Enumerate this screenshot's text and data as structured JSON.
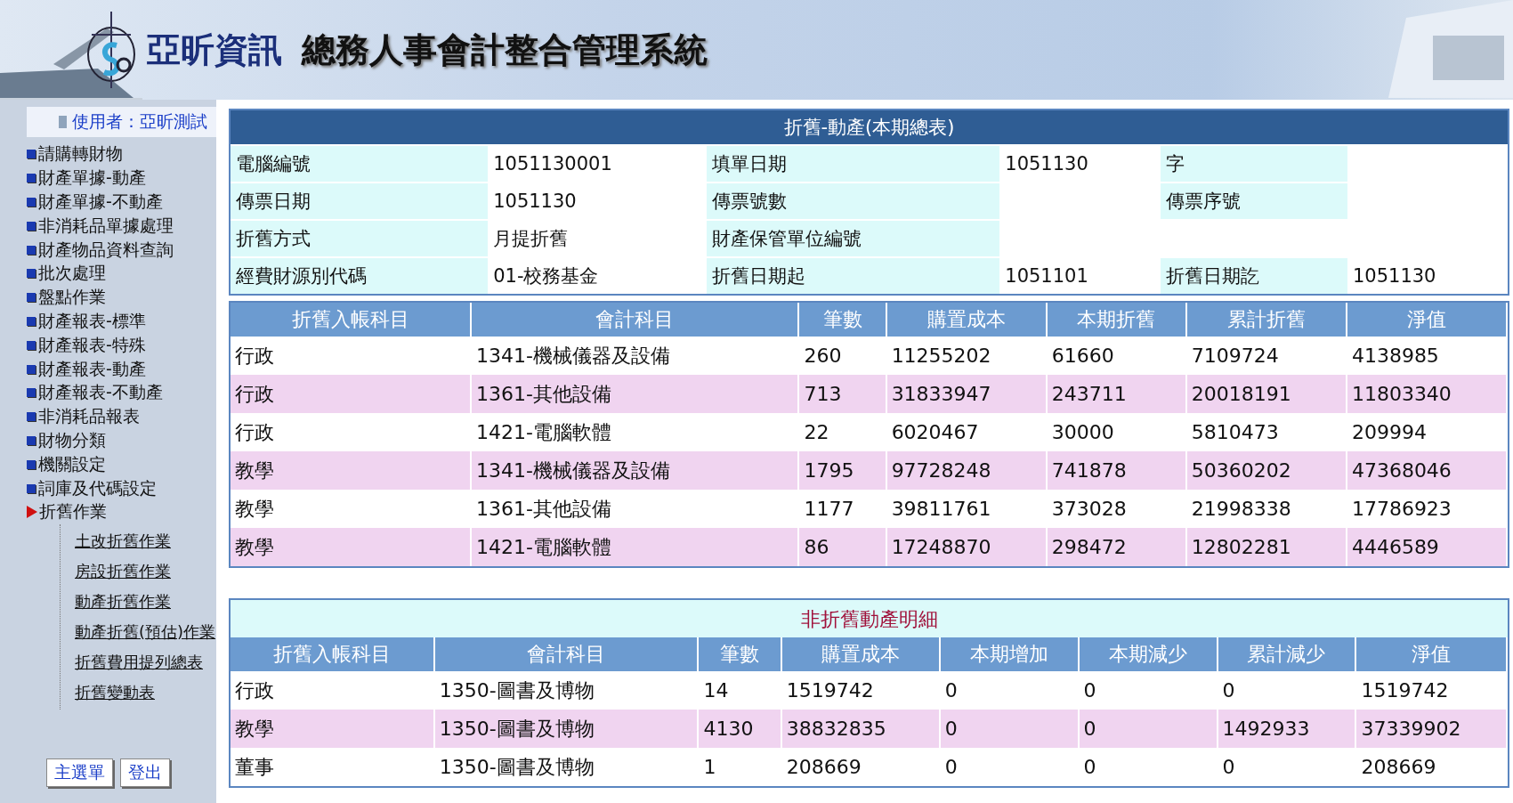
{
  "header": {
    "company": "亞昕資訊",
    "system": "總務人事會計整合管理系統"
  },
  "sidebar": {
    "user": "使用者：亞昕測試",
    "items": [
      {
        "label": "請購轉財物",
        "expanded": false
      },
      {
        "label": "財產單據-動產",
        "expanded": false
      },
      {
        "label": "財產單據-不動產",
        "expanded": false
      },
      {
        "label": "非消耗品單據處理",
        "expanded": false
      },
      {
        "label": "財產物品資料查詢",
        "expanded": false
      },
      {
        "label": "批次處理",
        "expanded": false
      },
      {
        "label": "盤點作業",
        "expanded": false
      },
      {
        "label": "財產報表-標準",
        "expanded": false
      },
      {
        "label": "財產報表-特殊",
        "expanded": false
      },
      {
        "label": "財產報表-動產",
        "expanded": false
      },
      {
        "label": "財產報表-不動產",
        "expanded": false
      },
      {
        "label": "非消耗品報表",
        "expanded": false
      },
      {
        "label": "財物分類",
        "expanded": false
      },
      {
        "label": "機關設定",
        "expanded": false
      },
      {
        "label": "詞庫及代碼設定",
        "expanded": false
      },
      {
        "label": "折舊作業",
        "expanded": true,
        "children": [
          {
            "label": "土改折舊作業"
          },
          {
            "label": "房設折舊作業"
          },
          {
            "label": "動產折舊作業"
          },
          {
            "label": "動產折舊(預估)作業"
          },
          {
            "label": "折舊費用提列總表"
          },
          {
            "label": "折舊變動表"
          }
        ]
      }
    ],
    "buttons": [
      "主選單",
      "登出"
    ]
  },
  "summary": {
    "title": "折舊-動產(本期總表)",
    "rows": [
      [
        {
          "kind": "label",
          "text": "電腦編號"
        },
        {
          "kind": "value",
          "text": "1051130001"
        },
        {
          "kind": "label",
          "text": "填單日期"
        },
        {
          "kind": "value",
          "text": "1051130"
        },
        {
          "kind": "label",
          "text": "字"
        },
        {
          "kind": "value"
        }
      ],
      [
        {
          "kind": "label",
          "text": "傳票日期"
        },
        {
          "kind": "value",
          "text": "1051130"
        },
        {
          "kind": "label",
          "text": "傳票號數"
        },
        {
          "kind": "value"
        },
        {
          "kind": "label",
          "text": "傳票序號"
        },
        {
          "kind": "value"
        }
      ],
      [
        {
          "kind": "label",
          "text": "折舊方式"
        },
        {
          "kind": "value",
          "text": "月提折舊"
        },
        {
          "kind": "label",
          "text": "財產保管單位編號"
        },
        {
          "kind": "value"
        },
        {
          "kind": "value"
        },
        {
          "kind": "value"
        }
      ],
      [
        {
          "kind": "label",
          "text": "經費財源別代碼"
        },
        {
          "kind": "value",
          "text": "01-校務基金"
        },
        {
          "kind": "label",
          "text": "折舊日期起"
        },
        {
          "kind": "value",
          "text": "1051101"
        },
        {
          "kind": "label",
          "text": "折舊日期訖"
        },
        {
          "kind": "value",
          "text": "1051130"
        }
      ]
    ]
  },
  "depreciation_table": {
    "columns": [
      "折舊入帳科目",
      "會計科目",
      "筆數",
      "購置成本",
      "本期折舊",
      "累計折舊",
      "淨值"
    ],
    "rows": [
      [
        "行政",
        "1341-機械儀器及設備",
        "260",
        "11255202",
        "61660",
        "7109724",
        "4138985"
      ],
      [
        "行政",
        "1361-其他設備",
        "713",
        "31833947",
        "243711",
        "20018191",
        "11803340"
      ],
      [
        "行政",
        "1421-電腦軟體",
        "22",
        "6020467",
        "30000",
        "5810473",
        "209994"
      ],
      [
        "教學",
        "1341-機械儀器及設備",
        "1795",
        "97728248",
        "741878",
        "50360202",
        "47368046"
      ],
      [
        "教學",
        "1361-其他設備",
        "1177",
        "39811761",
        "373028",
        "21998338",
        "17786923"
      ],
      [
        "教學",
        "1421-電腦軟體",
        "86",
        "17248870",
        "298472",
        "12802281",
        "4446589"
      ]
    ]
  },
  "non_depreciation_table": {
    "title": "非折舊動產明細",
    "columns": [
      "折舊入帳科目",
      "會計科目",
      "筆數",
      "購置成本",
      "本期增加",
      "本期減少",
      "累計減少",
      "淨值"
    ],
    "rows": [
      [
        "行政",
        "1350-圖書及博物",
        "14",
        "1519742",
        "0",
        "0",
        "0",
        "1519742"
      ],
      [
        "教學",
        "1350-圖書及博物",
        "4130",
        "38832835",
        "0",
        "0",
        "1492933",
        "37339902"
      ],
      [
        "董事",
        "1350-圖書及博物",
        "1",
        "208669",
        "0",
        "0",
        "0",
        "208669"
      ]
    ]
  }
}
